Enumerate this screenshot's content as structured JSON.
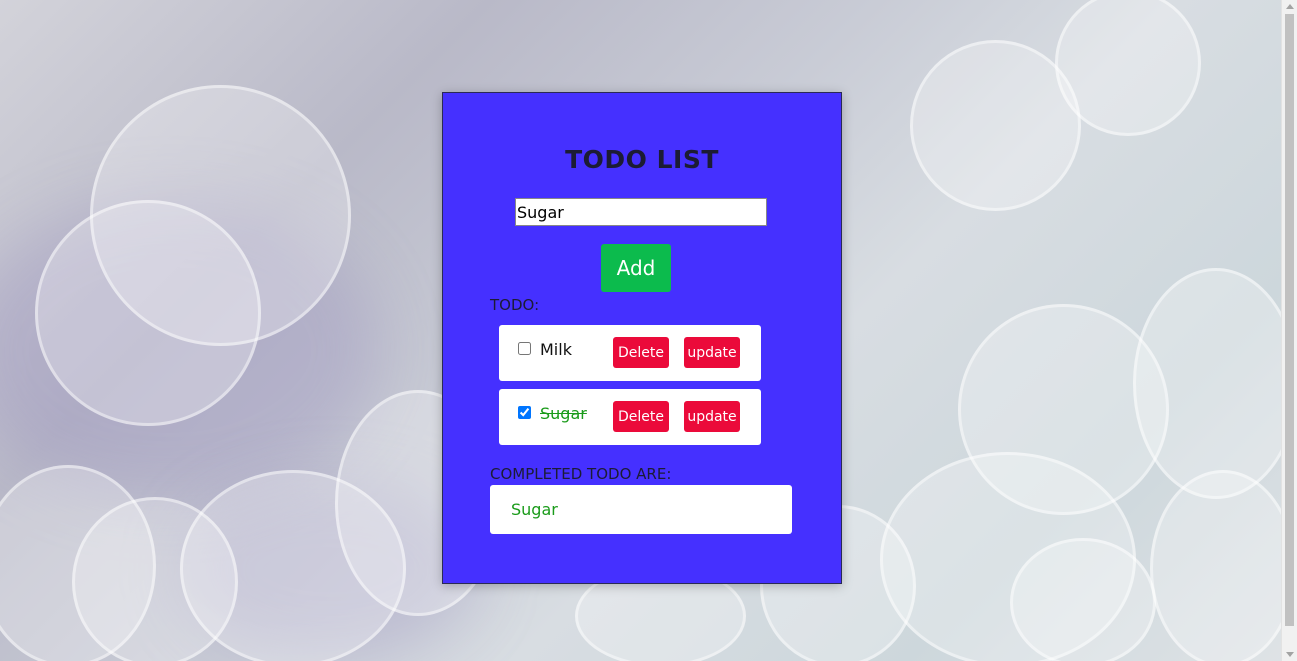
{
  "app": {
    "title": "TODO LIST"
  },
  "input": {
    "value": "Sugar",
    "placeholder": ""
  },
  "add_button": {
    "label": "Add"
  },
  "todo_section": {
    "label": "TODO:",
    "items": [
      {
        "text": "Milk",
        "checked": false,
        "delete_label": "Delete",
        "update_label": "update"
      },
      {
        "text": "Sugar",
        "checked": true,
        "delete_label": "Delete",
        "update_label": "update"
      }
    ]
  },
  "completed_section": {
    "label": "COMPLETED TODO ARE:",
    "items": [
      "Sugar"
    ]
  },
  "colors": {
    "card_background": "#4530ff",
    "add_button": "#0cbb4d",
    "delete_update_button": "#eb0a3a",
    "completed_text": "#1a9b1a"
  }
}
